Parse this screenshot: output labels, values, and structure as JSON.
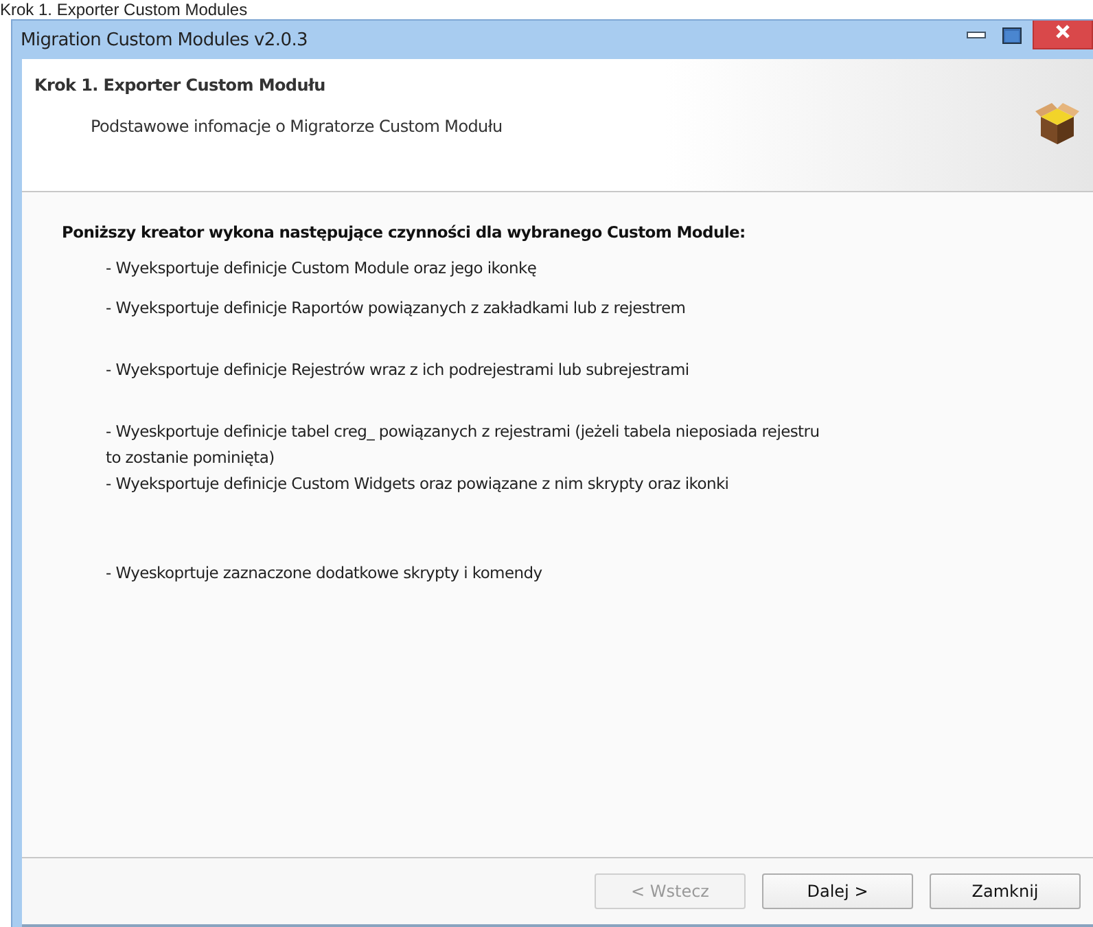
{
  "page_caption": "Krok 1. Exporter Custom Modules",
  "window": {
    "title": "Migration Custom Modules v2.0.3"
  },
  "header": {
    "title": "Krok 1. Exporter Custom Modułu",
    "subtitle": "Podstawowe infomacje o Migratorze Custom Modułu"
  },
  "content": {
    "intro": "Poniższy kreator wykona następujące czynności dla wybranego Custom Module:",
    "items": [
      "- Wyeksportuje definicje Custom Module oraz jego ikonkę",
      "- Wyeksportuje definicje Raportów powiązanych z zakładkami lub z rejestrem",
      "- Wyeksportuje definicje Rejestrów wraz z ich podrejestrami lub subrejestrami",
      "- Wyeskportuje definicje tabel creg_ powiązanych z rejestrami (jeżeli tabela nieposiada rejestru to zostanie pominięta)",
      "- Wyeksportuje definicje Custom Widgets oraz powiązane z nim skrypty oraz ikonki",
      "- Wyeskoprtuje zaznaczone dodatkowe skrypty i komendy"
    ]
  },
  "buttons": [
    {
      "label": "< Wstecz",
      "disabled": true
    },
    {
      "label": "Dalej >",
      "disabled": false
    },
    {
      "label": "Zamknij",
      "disabled": false
    }
  ]
}
